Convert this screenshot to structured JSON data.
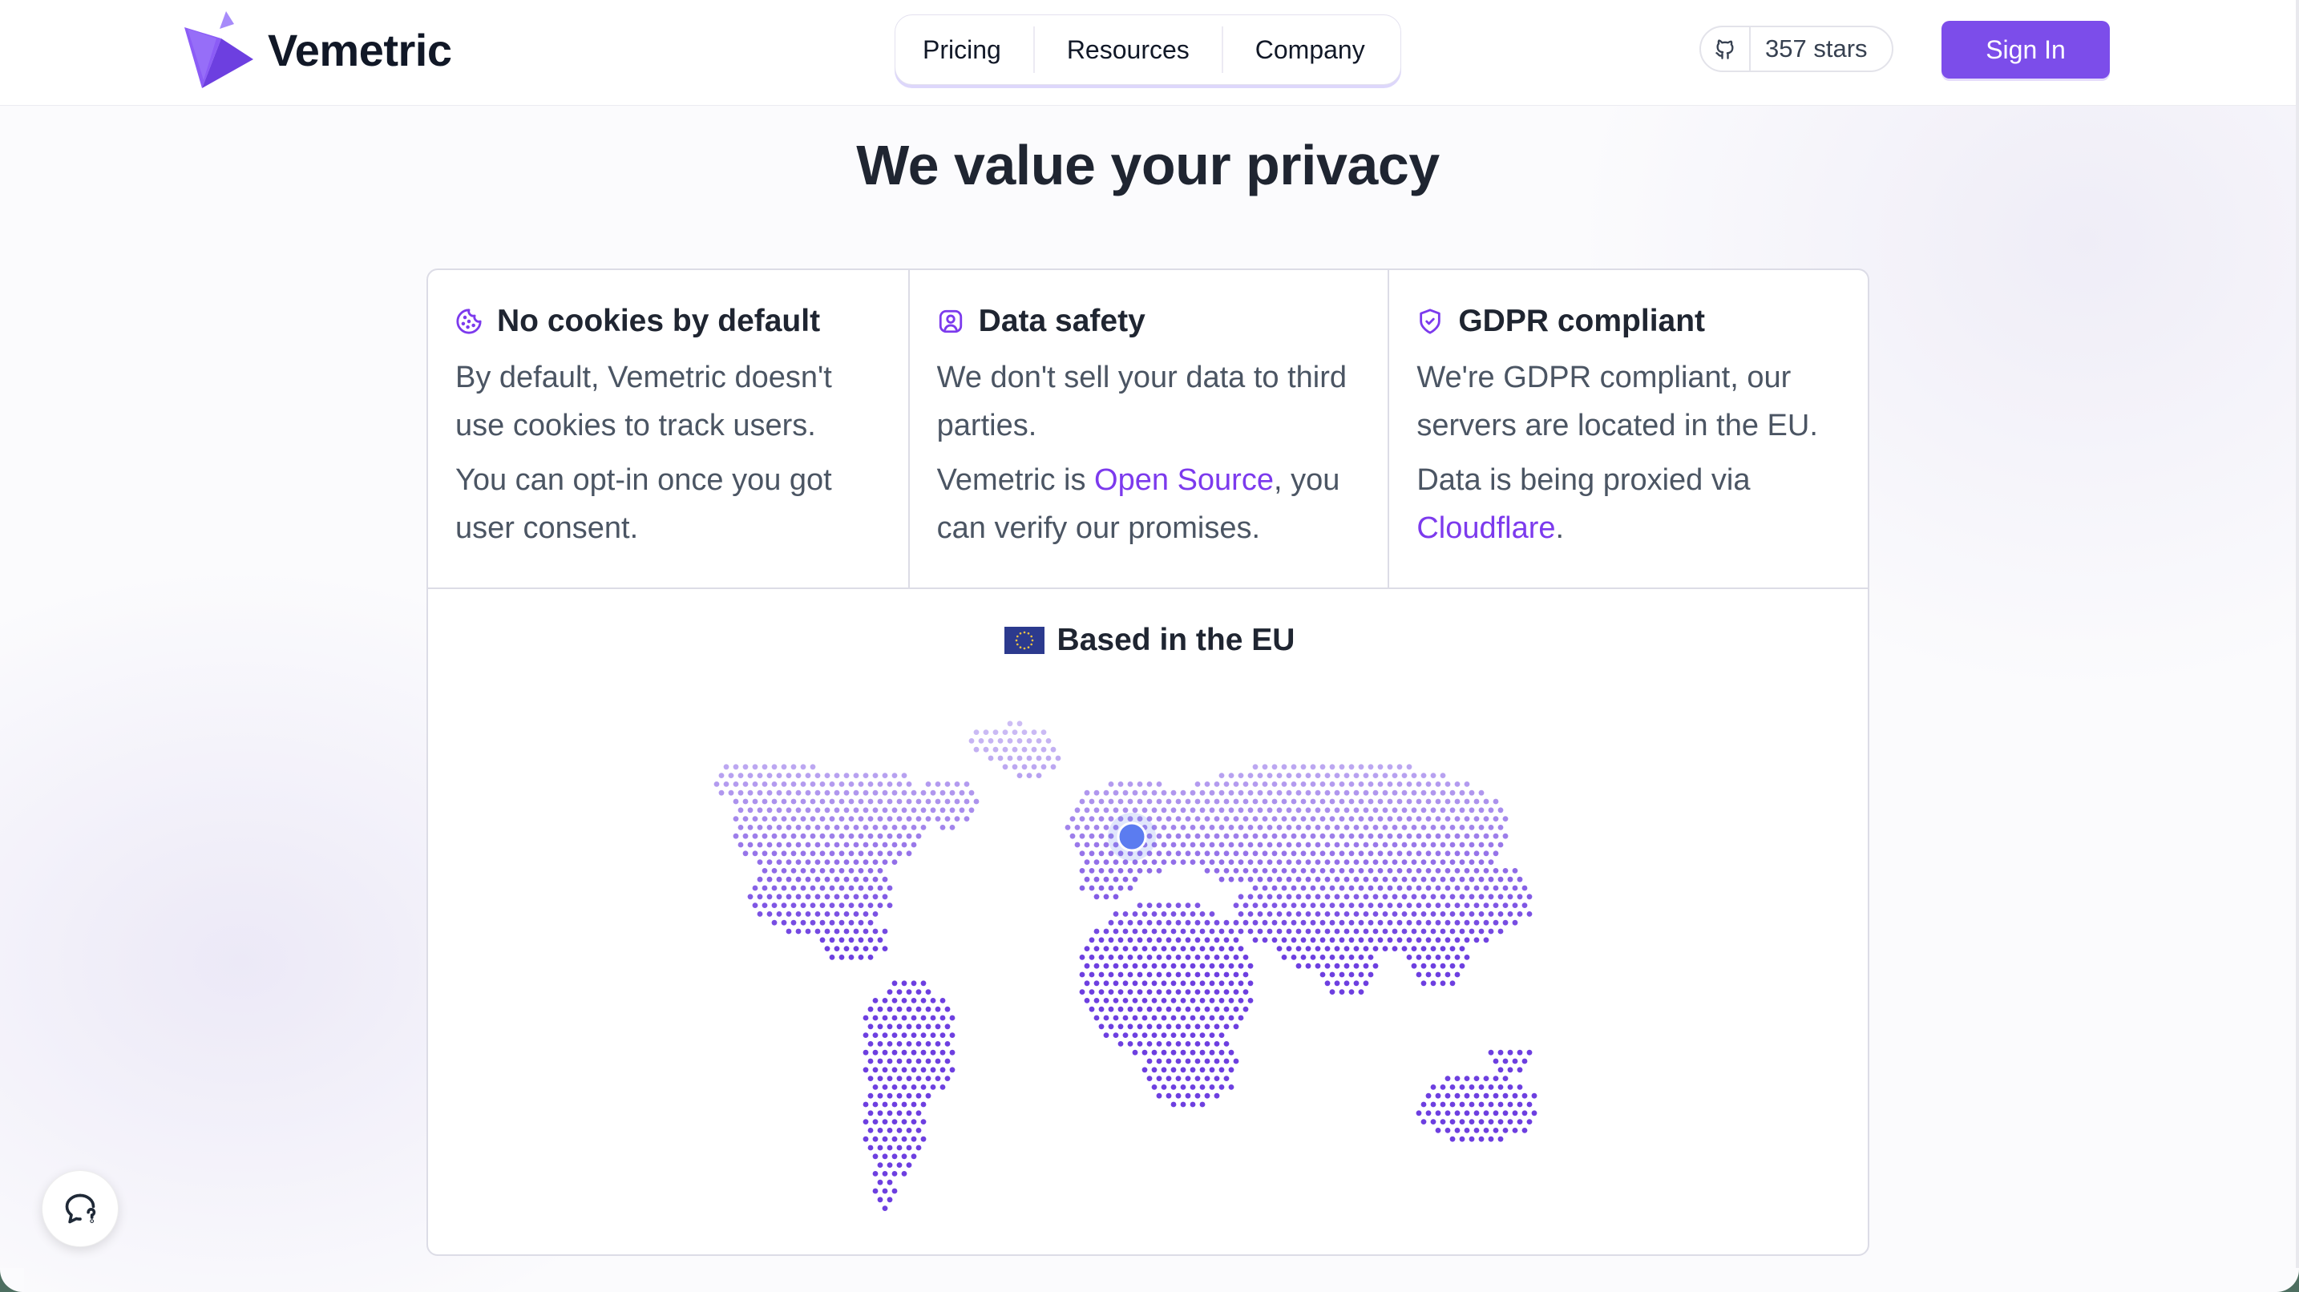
{
  "header": {
    "brand": "Vemetric",
    "nav": [
      "Pricing",
      "Resources",
      "Company"
    ],
    "github_stars": "357 stars",
    "sign_in": "Sign In"
  },
  "page": {
    "title": "We value your privacy"
  },
  "features": [
    {
      "icon": "cookie-icon",
      "title": "No cookies by default",
      "p1": "By default, Vemetric doesn't use cookies to track users.",
      "p2": "You can opt-in once you got user consent."
    },
    {
      "icon": "user-shield-icon",
      "title": "Data safety",
      "p1": "We don't sell your data to third parties.",
      "p2_pre": "Vemetric is ",
      "p2_link": "Open Source",
      "p2_post": ", you can verify our promises."
    },
    {
      "icon": "shield-icon",
      "title": "GDPR compliant",
      "p1": "We're GDPR compliant, our servers are located in the EU.",
      "p2_pre": "Data is being proxied via ",
      "p2_link": "Cloudflare",
      "p2_post": "."
    }
  ],
  "map": {
    "title": "Based in the EU",
    "flag_icon": "eu-flag-icon"
  },
  "colors": {
    "accent": "#7c4dea",
    "link": "#7c3aed",
    "dot": "#6d3fe0",
    "marker": "#5b7cf0"
  },
  "chat_icon": "chat-icon"
}
